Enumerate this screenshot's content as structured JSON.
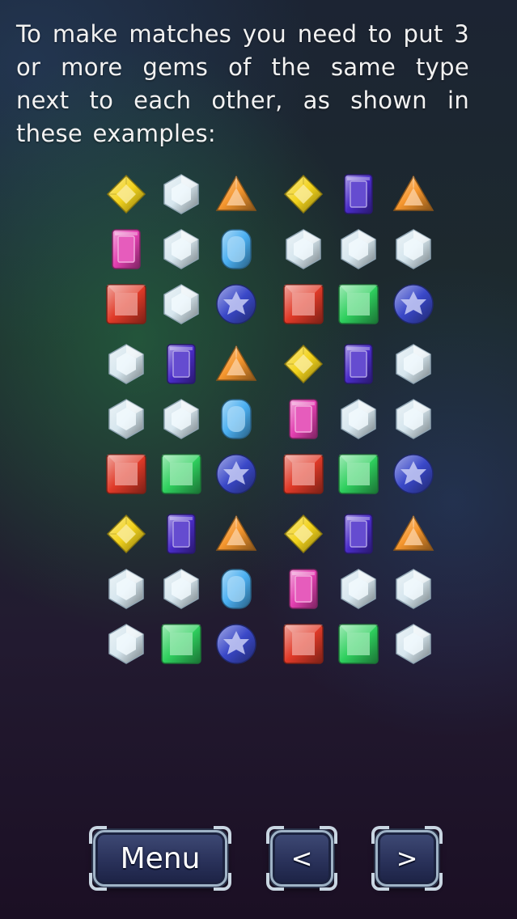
{
  "instruction": "To make matches you need to put 3 or more gems of the same type next to each other, as shown in these examples:",
  "gem_colors": {
    "yellow": "#f2d21c",
    "white": "#d6e6ee",
    "orange": "#f5962e",
    "pink": "#e23fb0",
    "lightblue": "#4aaef0",
    "red": "#e03a28",
    "blue": "#3a48c8",
    "purple": "#4a2cc8",
    "green": "#2fd05e"
  },
  "examples": [
    [
      [
        "yellow-gem",
        "white-gem",
        "orange-gem"
      ],
      [
        "pink-gem",
        "white-gem",
        "lightblue-gem"
      ],
      [
        "red-gem",
        "white-gem",
        "blue-gem"
      ]
    ],
    [
      [
        "yellow-gem",
        "purple-gem",
        "orange-gem"
      ],
      [
        "white-gem",
        "white-gem",
        "white-gem"
      ],
      [
        "red-gem",
        "green-gem",
        "blue-gem"
      ]
    ],
    [
      [
        "white-gem",
        "purple-gem",
        "orange-gem"
      ],
      [
        "white-gem",
        "white-gem",
        "lightblue-gem"
      ],
      [
        "red-gem",
        "green-gem",
        "blue-gem"
      ]
    ],
    [
      [
        "yellow-gem",
        "purple-gem",
        "white-gem"
      ],
      [
        "pink-gem",
        "white-gem",
        "white-gem"
      ],
      [
        "red-gem",
        "green-gem",
        "blue-gem"
      ]
    ],
    [
      [
        "yellow-gem",
        "purple-gem",
        "orange-gem"
      ],
      [
        "white-gem",
        "white-gem",
        "lightblue-gem"
      ],
      [
        "white-gem",
        "green-gem",
        "blue-gem"
      ]
    ],
    [
      [
        "yellow-gem",
        "purple-gem",
        "orange-gem"
      ],
      [
        "pink-gem",
        "white-gem",
        "white-gem"
      ],
      [
        "red-gem",
        "green-gem",
        "white-gem"
      ]
    ]
  ],
  "buttons": {
    "menu": "Menu",
    "prev": "<",
    "next": ">"
  }
}
